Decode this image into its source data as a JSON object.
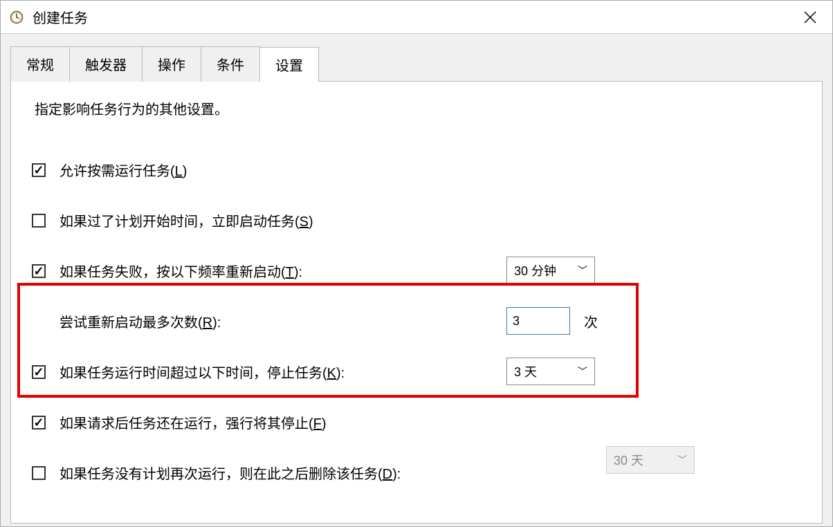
{
  "window": {
    "title": "创建任务",
    "close": "✕"
  },
  "tabs": {
    "general": "常规",
    "triggers": "触发器",
    "actions": "操作",
    "conditions": "条件",
    "settings": "设置"
  },
  "panel": {
    "description": "指定影响任务行为的其他设置。"
  },
  "settings": {
    "allow_on_demand": {
      "label_pre": "允许按需运行任务(",
      "hotkey": "L",
      "label_post": ")"
    },
    "run_asap": {
      "label_pre": "如果过了计划开始时间，立即启动任务(",
      "hotkey": "S",
      "label_post": ")"
    },
    "restart_on_fail": {
      "label_pre": "如果任务失败，按以下频率重新启动(",
      "hotkey": "T",
      "label_post": "):",
      "interval": "30 分钟"
    },
    "retry_count": {
      "label_pre": "尝试重新启动最多次数(",
      "hotkey": "R",
      "label_post": "):",
      "value": "3",
      "suffix": "次"
    },
    "stop_after": {
      "label_pre": "如果任务运行时间超过以下时间，停止任务(",
      "hotkey": "K",
      "label_post": "):",
      "value": "3 天"
    },
    "force_stop": {
      "label_pre": "如果请求后任务还在运行，强行将其停止(",
      "hotkey": "F",
      "label_post": ")"
    },
    "delete_after": {
      "label_pre": "如果任务没有计划再次运行，则在此之后删除该任务(",
      "hotkey": "D",
      "label_post": "):",
      "value": "30 天"
    }
  }
}
